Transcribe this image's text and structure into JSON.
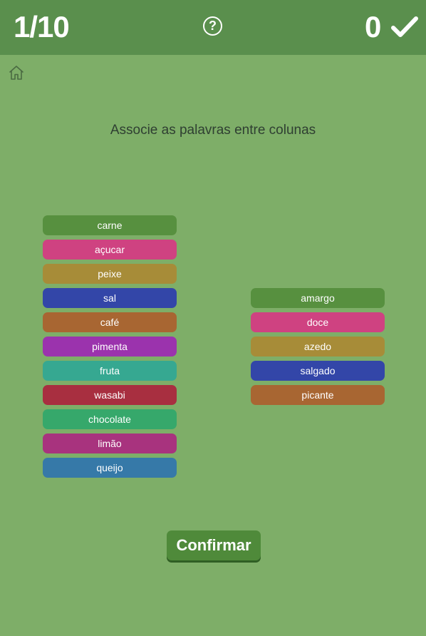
{
  "header": {
    "progress": "1/10",
    "help_symbol": "?",
    "score": "0",
    "check_icon": "check-icon"
  },
  "home_icon": "home-icon",
  "instruction": "Associe as palavras entre colunas",
  "left_column": [
    {
      "label": "carne",
      "color": "#57903f"
    },
    {
      "label": "açucar",
      "color": "#cf4281"
    },
    {
      "label": "peixe",
      "color": "#a78c38"
    },
    {
      "label": "sal",
      "color": "#3346a8"
    },
    {
      "label": "café",
      "color": "#a86632"
    },
    {
      "label": "pimenta",
      "color": "#9b33ad"
    },
    {
      "label": "fruta",
      "color": "#36a891"
    },
    {
      "label": "wasabi",
      "color": "#a82f40"
    },
    {
      "label": "chocolate",
      "color": "#36a86b"
    },
    {
      "label": "limão",
      "color": "#a8337e"
    },
    {
      "label": "queijo",
      "color": "#3679a8"
    }
  ],
  "right_column": [
    {
      "label": "amargo",
      "color": "#57903f"
    },
    {
      "label": "doce",
      "color": "#cf4281"
    },
    {
      "label": "azedo",
      "color": "#a78c38"
    },
    {
      "label": "salgado",
      "color": "#3346a8"
    },
    {
      "label": "picante",
      "color": "#a86632"
    }
  ],
  "confirm_label": "Confirmar"
}
